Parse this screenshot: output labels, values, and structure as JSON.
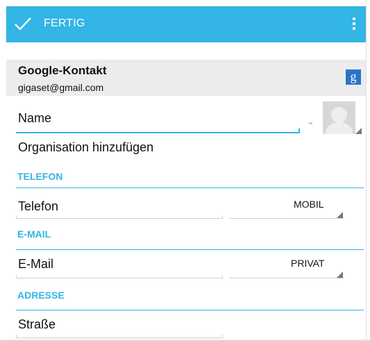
{
  "actionbar": {
    "done_label": "FERTIG",
    "check_icon": "check-icon",
    "overflow_icon": "overflow-menu-icon",
    "color": "#33b5e5"
  },
  "account": {
    "type": "Google-Kontakt",
    "email": "gigaset@gmail.com",
    "icon_letter": "g"
  },
  "fields": {
    "name_placeholder": "Name",
    "organisation_label": "Organisation hinzufügen",
    "phone_section": "TELEFON",
    "phone_placeholder": "Telefon",
    "phone_type": "MOBIL",
    "email_section": "E-MAIL",
    "email_placeholder": "E-Mail",
    "email_type": "PRIVAT",
    "address_section": "ADRESSE",
    "street_placeholder": "Straße"
  }
}
